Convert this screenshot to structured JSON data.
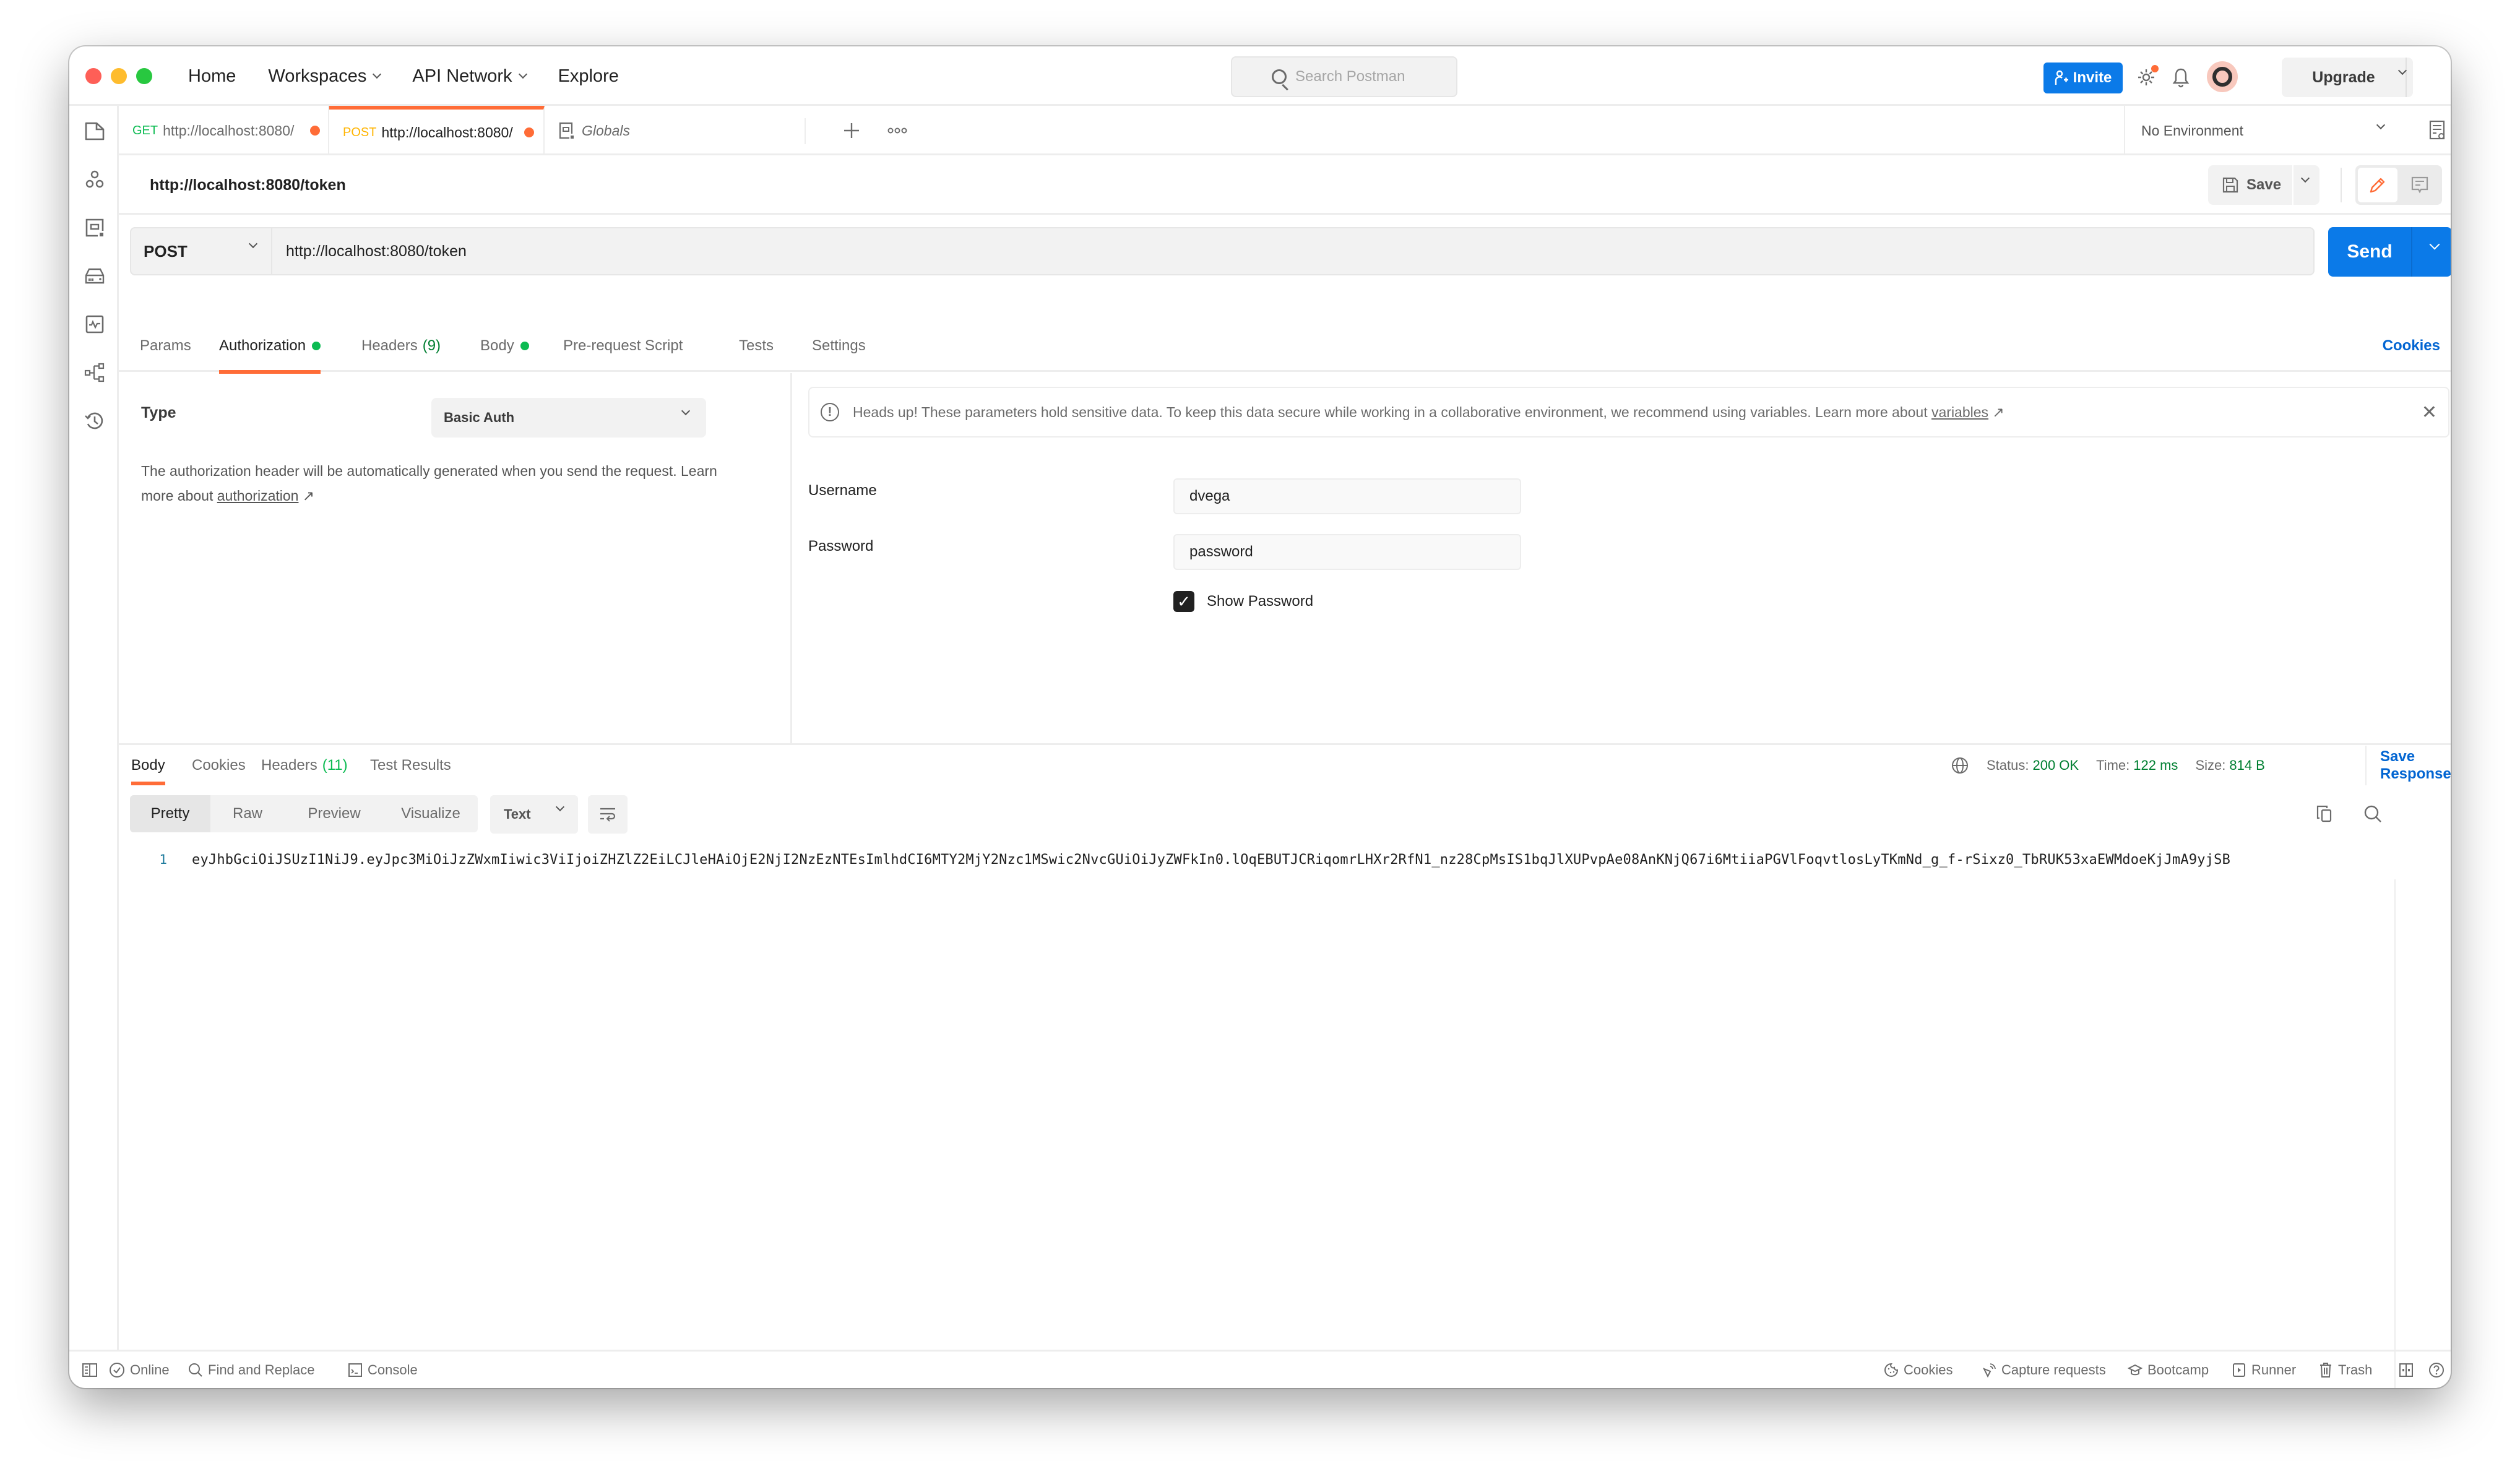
{
  "titlebar": {
    "nav": [
      {
        "label": "Home",
        "has_dropdown": false
      },
      {
        "label": "Workspaces",
        "has_dropdown": true
      },
      {
        "label": "API Network",
        "has_dropdown": true
      },
      {
        "label": "Explore",
        "has_dropdown": false
      }
    ],
    "search_placeholder": "Search Postman",
    "invite_label": "Invite",
    "upgrade_label": "Upgrade"
  },
  "sidebar": {
    "icons": [
      "collections-icon",
      "apis-icon",
      "environments-icon",
      "mock-servers-icon",
      "monitors-icon",
      "flows-icon",
      "history-icon"
    ]
  },
  "tabs": [
    {
      "method": "GET",
      "method_color": "#0cbb52",
      "label": "http://localhost:8080/",
      "unsaved": true,
      "active": false
    },
    {
      "method": "POST",
      "method_color": "#ffb400",
      "label": "http://localhost:8080/",
      "unsaved": true,
      "active": true
    },
    {
      "method": "",
      "label": "Globals",
      "unsaved": false,
      "active": false
    }
  ],
  "environment": {
    "selected": "No Environment"
  },
  "request": {
    "name": "http://localhost:8080/token",
    "save_label": "Save",
    "method": "POST",
    "url": "http://localhost:8080/token",
    "send_label": "Send",
    "cookies_label": "Cookies",
    "tabs": [
      {
        "label": "Params"
      },
      {
        "label": "Authorization",
        "dot": true,
        "active": true
      },
      {
        "label": "Headers",
        "count": "(9)"
      },
      {
        "label": "Body",
        "dot": true
      },
      {
        "label": "Pre-request Script"
      },
      {
        "label": "Tests"
      },
      {
        "label": "Settings"
      }
    ]
  },
  "auth": {
    "type_label": "Type",
    "type_value": "Basic Auth",
    "description_prefix": "The authorization header will be automatically generated when you send the request. Learn more about ",
    "description_link": "authorization",
    "banner_text": "Heads up! These parameters hold sensitive data. To keep this data secure while working in a collaborative environment, we recommend using variables. Learn more about ",
    "banner_link": "variables",
    "username_label": "Username",
    "username_value": "dvega",
    "password_label": "Password",
    "password_value": "password",
    "show_password_label": "Show Password",
    "show_password_checked": true
  },
  "response": {
    "tabs": [
      {
        "label": "Body",
        "active": true
      },
      {
        "label": "Cookies"
      },
      {
        "label": "Headers",
        "count": "(11)"
      },
      {
        "label": "Test Results"
      }
    ],
    "status_label": "Status:",
    "status_value": "200 OK",
    "time_label": "Time:",
    "time_value": "122 ms",
    "size_label": "Size:",
    "size_value": "814 B",
    "save_response_label": "Save Response",
    "view_modes": [
      "Pretty",
      "Raw",
      "Preview",
      "Visualize"
    ],
    "active_view_mode": "Pretty",
    "format": "Text",
    "lines": [
      {
        "number": "1",
        "text": "eyJhbGciOiJSUzI1NiJ9.eyJpc3MiOiJzZWxmIiwic3ViIjoiZHZlZ2EiLCJleHAiOjE2NjI2NzEzNTEsImlhdCI6MTY2MjY2Nzc1MSwic2NvcGUiOiJyZWFkIn0.lOqEBUTJCRiqomrLHXr2RfN1_nz28CpMsIS1bqJlXUPvpAe08AnKNjQ67i6MtiiaPGVlFoqvtlosLyTKmNd_g_f-rSixz0_TbRUK53xaEWMdoeKjJmA9yjSB"
      }
    ]
  },
  "footer": {
    "left": [
      {
        "icon": "two-pane-icon",
        "label": ""
      },
      {
        "icon": "online-check-icon",
        "label": "Online"
      },
      {
        "icon": "search-icon",
        "label": "Find and Replace"
      },
      {
        "icon": "console-icon",
        "label": "Console"
      }
    ],
    "right": [
      {
        "icon": "cookie-icon",
        "label": "Cookies"
      },
      {
        "icon": "capture-icon",
        "label": "Capture requests"
      },
      {
        "icon": "bootcamp-icon",
        "label": "Bootcamp"
      },
      {
        "icon": "runner-icon",
        "label": "Runner"
      },
      {
        "icon": "trash-icon",
        "label": "Trash"
      },
      {
        "icon": "layout-icon",
        "label": ""
      },
      {
        "icon": "help-icon",
        "label": ""
      }
    ]
  },
  "colors": {
    "accent": "#ff6c37",
    "primary": "#0b7ae8",
    "link": "#0265d2",
    "success": "#007f31"
  }
}
